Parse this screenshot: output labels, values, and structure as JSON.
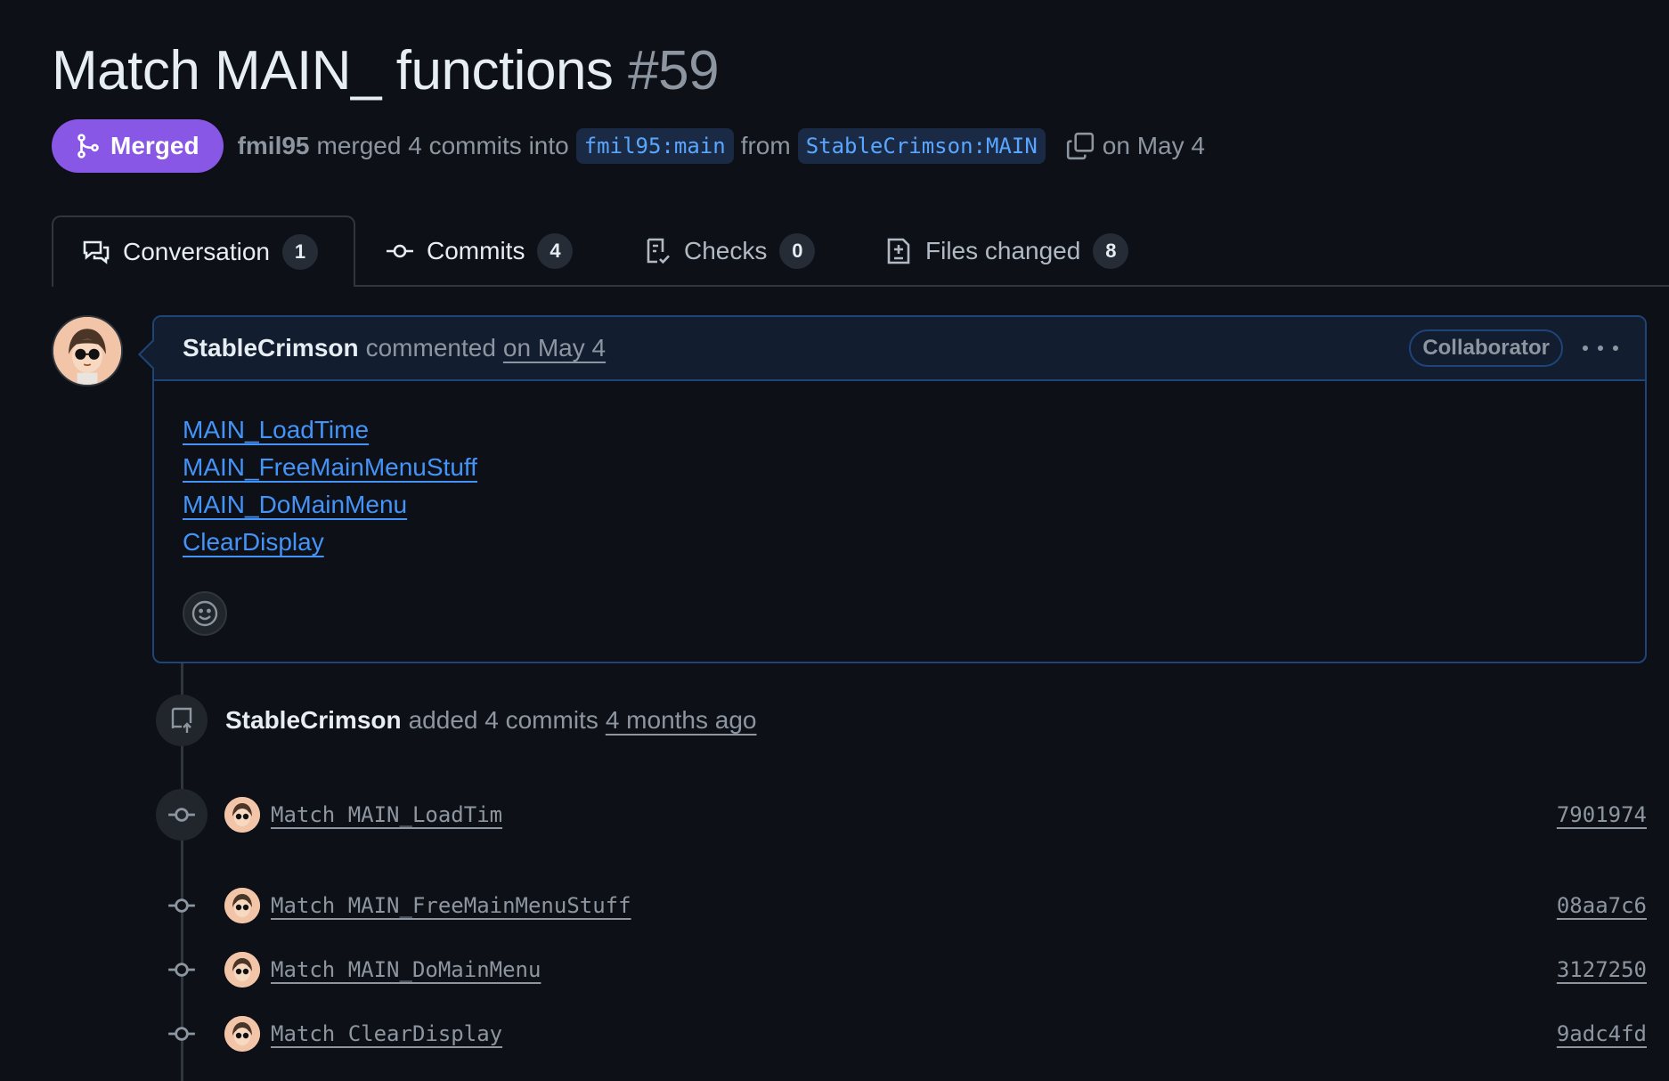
{
  "pr": {
    "title": "Match MAIN_ functions",
    "number": "#59",
    "state": "Merged",
    "merger": "fmil95",
    "merge_text": "merged 4 commits into",
    "base_branch": "fmil95:main",
    "from_text": "from",
    "head_branch": "StableCrimson:MAIN",
    "date_text": "on May 4"
  },
  "tabs": [
    {
      "label": "Conversation",
      "count": "1",
      "icon": "comment-discussion-icon"
    },
    {
      "label": "Commits",
      "count": "4",
      "icon": "git-commit-icon"
    },
    {
      "label": "Checks",
      "count": "0",
      "icon": "checklist-icon"
    },
    {
      "label": "Files changed",
      "count": "8",
      "icon": "file-diff-icon"
    }
  ],
  "comment": {
    "author": "StableCrimson",
    "action": "commented",
    "date": "on May 4",
    "role": "Collaborator",
    "links": [
      "MAIN_LoadTime",
      "MAIN_FreeMainMenuStuff",
      "MAIN_DoMainMenu",
      "ClearDisplay"
    ]
  },
  "event": {
    "author": "StableCrimson",
    "action": "added 4 commits",
    "when": "4 months ago"
  },
  "commits": [
    {
      "message": "Match MAIN_LoadTim",
      "sha": "7901974"
    },
    {
      "message": "Match MAIN_FreeMainMenuStuff",
      "sha": "08aa7c6"
    },
    {
      "message": "Match MAIN_DoMainMenu",
      "sha": "3127250"
    },
    {
      "message": "Match ClearDisplay",
      "sha": "9adc4fd"
    }
  ],
  "colors": {
    "background": "#0d1117",
    "merged": "#8957e5",
    "link": "#4493f8",
    "muted": "#8d96a0",
    "comment_border": "#1f4478"
  }
}
